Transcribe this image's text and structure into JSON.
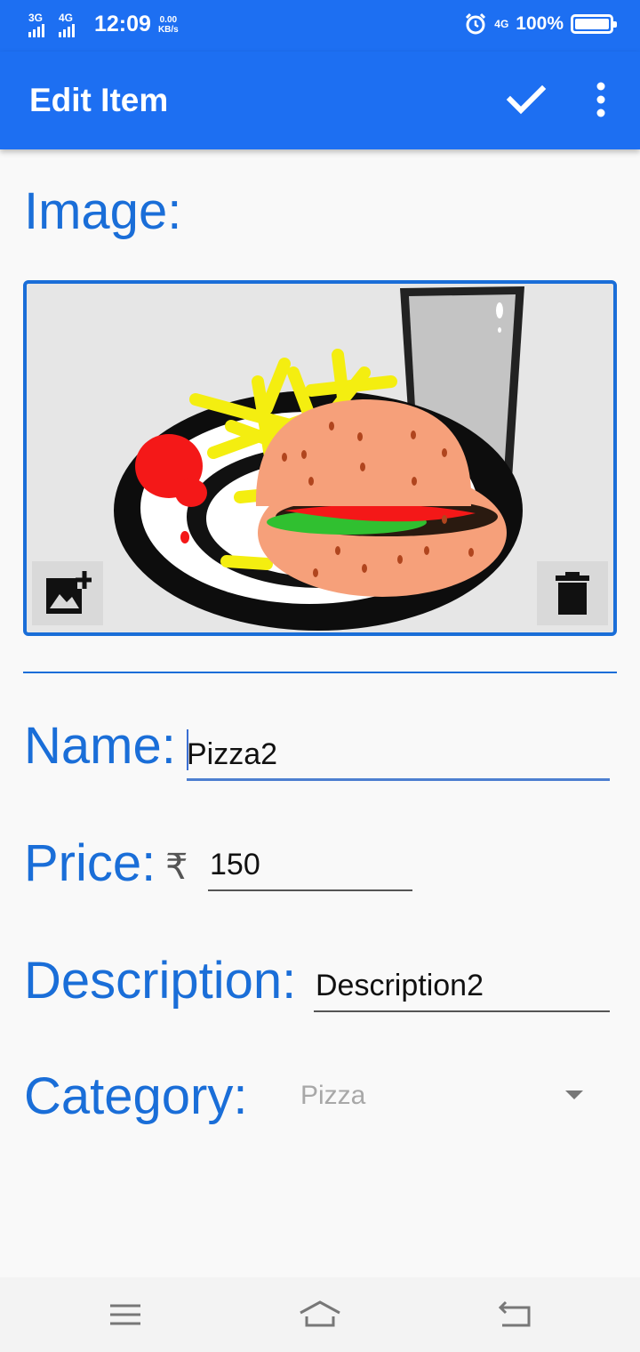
{
  "status_bar": {
    "net1": "3G",
    "net2": "4G",
    "time": "12:09",
    "speed_value": "0.00",
    "speed_unit": "KB/s",
    "net_right": "4G",
    "battery_text": "100%",
    "battery_level": 1.0
  },
  "app_bar": {
    "title": "Edit Item",
    "save_icon": "check-icon",
    "menu_icon": "more-vert-icon"
  },
  "form": {
    "image_label": "Image:",
    "image_content": "burger, fries and drink illustration",
    "add_image_icon": "add-photo-icon",
    "delete_image_icon": "delete-icon",
    "name_label": "Name:",
    "name_value": "Pizza2",
    "price_label": "Price:",
    "currency_symbol": "₹",
    "price_value": "150",
    "description_label": "Description:",
    "description_value": "Description2",
    "category_label": "Category:",
    "category_value": "Pizza"
  },
  "nav_bar": {
    "menu_icon": "menu-icon",
    "home_icon": "home-icon",
    "back_icon": "back-icon"
  },
  "colors": {
    "primary": "#1d6ff2",
    "label": "#1a6ed8",
    "focus_underline": "#4d7fd0",
    "hint": "#a8a8a8"
  }
}
